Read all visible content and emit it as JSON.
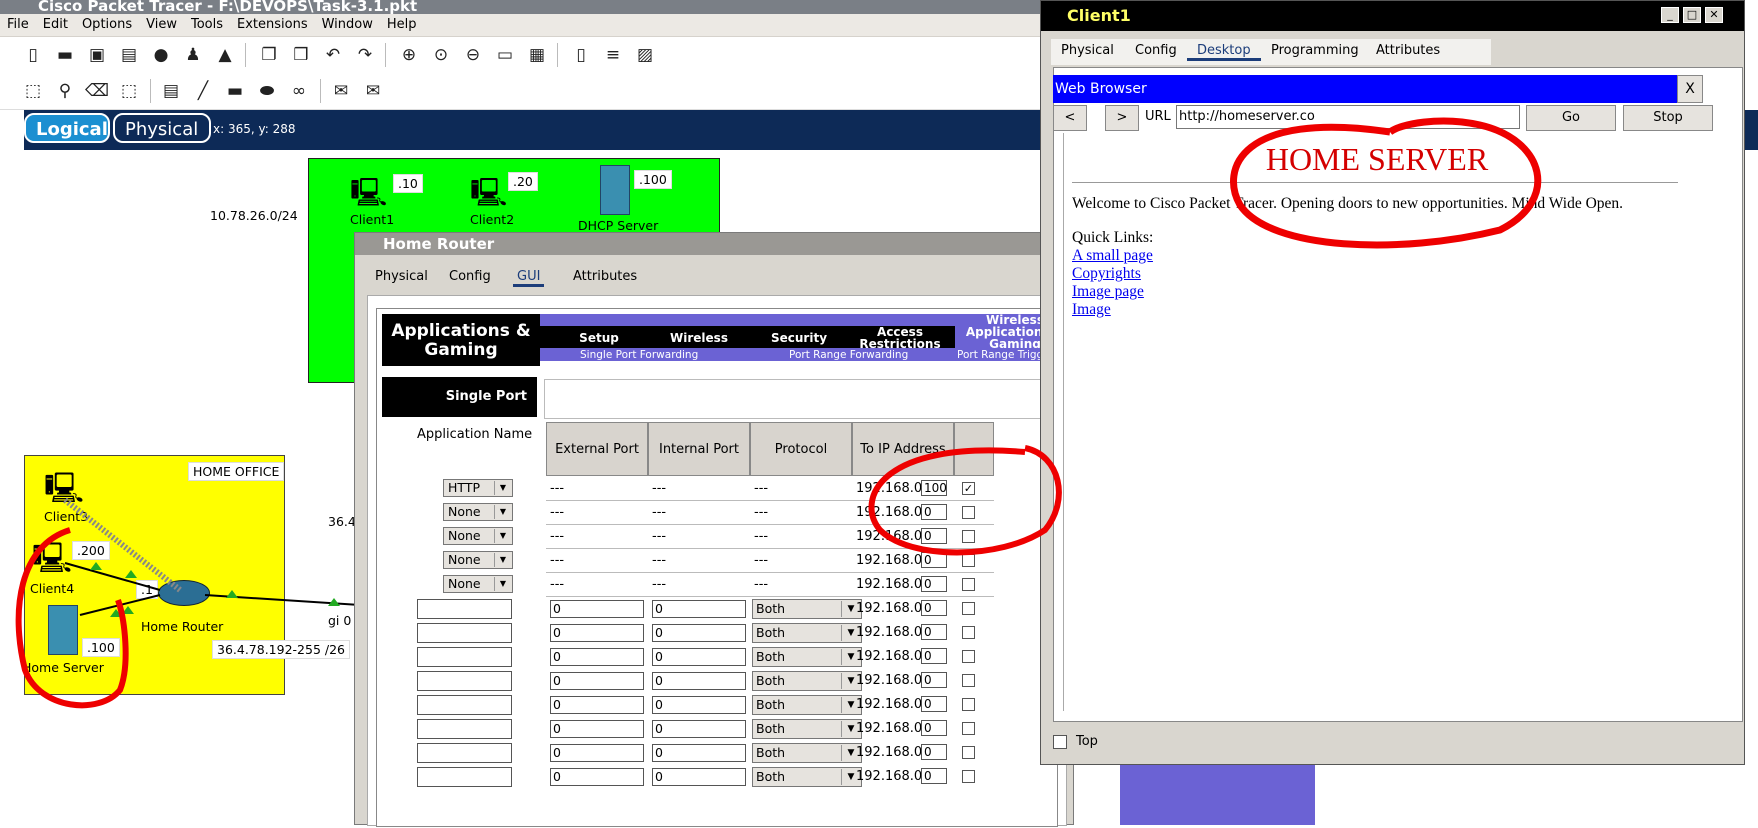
{
  "app": {
    "title": "Cisco Packet Tracer - F:\\DEVOPS\\Task-3.1.pkt",
    "menu": [
      "File",
      "Edit",
      "Options",
      "View",
      "Tools",
      "Extensions",
      "Window",
      "Help"
    ],
    "view_logical": "Logical",
    "view_physical": "Physical",
    "coords": "x: 365, y: 288"
  },
  "canvas": {
    "net1": "10.78.26.0/24",
    "client1": "Client1",
    "client1_ip": ".10",
    "client2": "Client2",
    "client2_ip": ".20",
    "dhcp": "DHCP Server",
    "dhcp_ip": ".100",
    "home_office": "HOME OFFICE",
    "client3": "Client3",
    "client4": "Client4",
    "client4_ip": ".200",
    "router": "Home Router",
    "router_ip": ".1",
    "server": "Home Server",
    "server_ip": ".100",
    "wan": "36.4.78.192-255 /26",
    "wan_partial": "36.4",
    "gi": "gi 0"
  },
  "home_router": {
    "title": "Home Router",
    "tabs": [
      "Physical",
      "Config",
      "GUI",
      "Attributes"
    ],
    "section": "Applications & Gaming",
    "nav": [
      "Setup",
      "Wireless",
      "Security",
      "Access Restrictions",
      "Wireless Applications & Gaming"
    ],
    "subnav": [
      "Single Port Forwarding",
      "Port Range Forwarding",
      "Port Range Triggering"
    ],
    "single_port": "Single Port",
    "app_name": "Application Name",
    "headers": [
      "External Port",
      "Internal Port",
      "Protocol",
      "To IP Address"
    ],
    "preset_rows": [
      {
        "app": "HTTP",
        "ext": "---",
        "int": "---",
        "proto": "---",
        "ip": "192.168.0.",
        "last": "100",
        "checked": true
      },
      {
        "app": "None",
        "ext": "---",
        "int": "---",
        "proto": "---",
        "ip": "192.168.0.",
        "last": "0",
        "checked": false
      },
      {
        "app": "None",
        "ext": "---",
        "int": "---",
        "proto": "---",
        "ip": "192.168.0.",
        "last": "0",
        "checked": false
      },
      {
        "app": "None",
        "ext": "---",
        "int": "---",
        "proto": "---",
        "ip": "192.168.0.",
        "last": "0",
        "checked": false
      },
      {
        "app": "None",
        "ext": "---",
        "int": "---",
        "proto": "---",
        "ip": "192.168.0.",
        "last": "0",
        "checked": false
      }
    ],
    "custom_rows": [
      {
        "ext": "0",
        "int": "0",
        "proto": "Both",
        "ip": "192.168.0.",
        "last": "0"
      },
      {
        "ext": "0",
        "int": "0",
        "proto": "Both",
        "ip": "192.168.0.",
        "last": "0"
      },
      {
        "ext": "0",
        "int": "0",
        "proto": "Both",
        "ip": "192.168.0.",
        "last": "0"
      },
      {
        "ext": "0",
        "int": "0",
        "proto": "Both",
        "ip": "192.168.0.",
        "last": "0"
      },
      {
        "ext": "0",
        "int": "0",
        "proto": "Both",
        "ip": "192.168.0.",
        "last": "0"
      },
      {
        "ext": "0",
        "int": "0",
        "proto": "Both",
        "ip": "192.168.0.",
        "last": "0"
      },
      {
        "ext": "0",
        "int": "0",
        "proto": "Both",
        "ip": "192.168.0.",
        "last": "0"
      },
      {
        "ext": "0",
        "int": "0",
        "proto": "Both",
        "ip": "192.168.0.",
        "last": "0"
      }
    ]
  },
  "client1": {
    "title": "Client1",
    "tabs": [
      "Physical",
      "Config",
      "Desktop",
      "Programming",
      "Attributes"
    ],
    "browser_title": "Web Browser",
    "close": "X",
    "back": "<",
    "fwd": ">",
    "url_label": "URL",
    "url": "http://homeserver.co",
    "go": "Go",
    "stop": "Stop",
    "heading": "HOME SERVER",
    "welcome": "Welcome to Cisco Packet Tracer. Opening doors to new opportunities. Mind Wide Open.",
    "quick_links": "Quick Links:",
    "links": [
      "A small page",
      "Copyrights",
      "Image page",
      "Image"
    ],
    "top_label": "Top"
  }
}
